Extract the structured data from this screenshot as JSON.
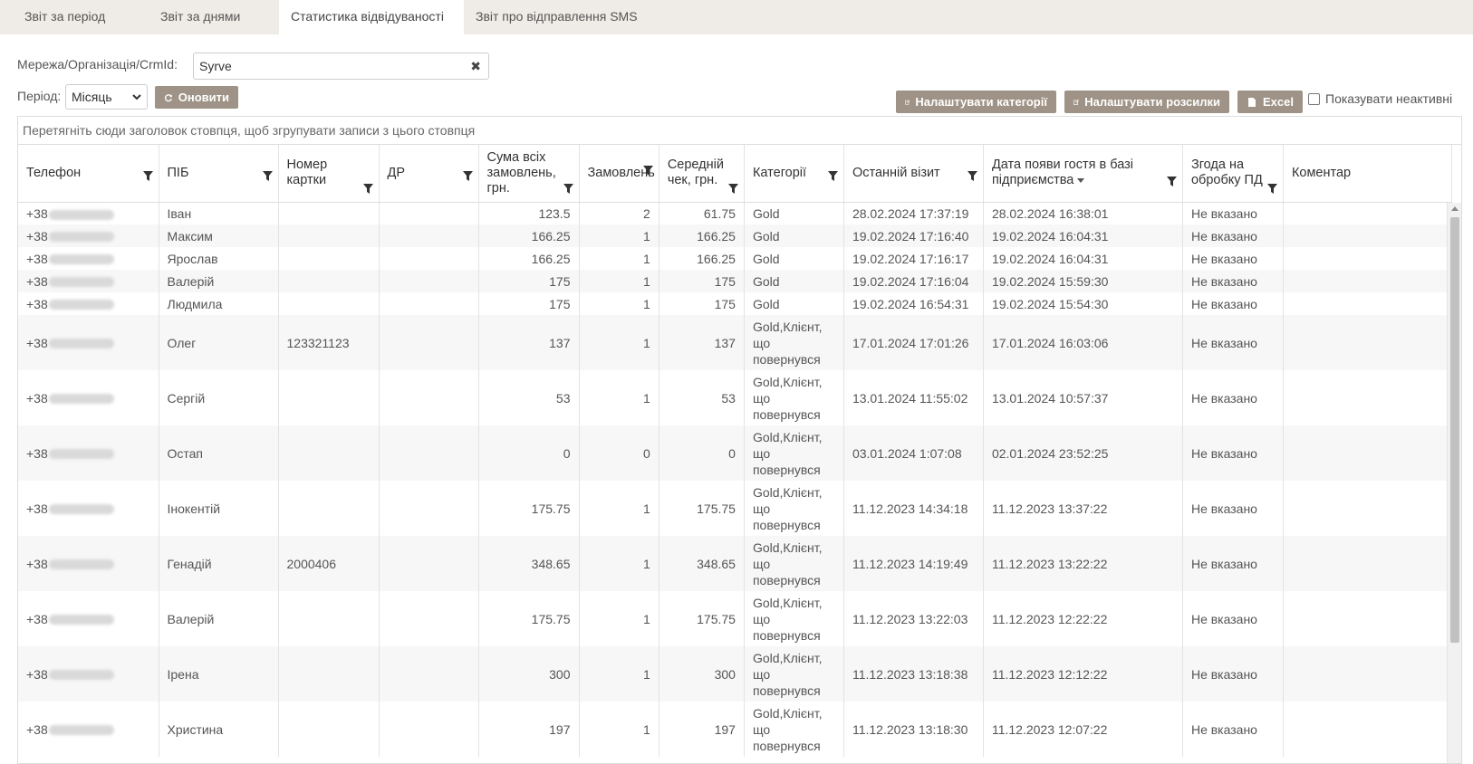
{
  "tabs": [
    {
      "label": "Звіт за період"
    },
    {
      "label": "Звіт за днями"
    },
    {
      "label": "Статистика відвідуваності"
    },
    {
      "label": "Звіт про відправлення SMS"
    }
  ],
  "filters": {
    "org_label": "Мережа/Організація/CrmId:",
    "org_value": "Syrve",
    "clear_glyph": "✖",
    "period_label": "Період:",
    "period_value": "Місяць",
    "refresh_label": "Оновити"
  },
  "actions": {
    "categories_label": "Налаштувати категорії",
    "mailings_label": "Налаштувати розсилки",
    "excel_label": "Excel",
    "show_inactive_label": "Показувати неактивні"
  },
  "grid": {
    "group_hint": "Перетягніть сюди заголовок стовпця, щоб згрупувати записи з цього стовпця",
    "columns": [
      "Телефон",
      "ПІБ",
      "Номер картки",
      "ДР",
      "Сума всіх замовлень, грн.",
      "Замовлень",
      "Середній чек, грн.",
      "Категорії",
      "Останній візит",
      "Дата появи гостя в базі підприємства",
      "Згода на обробку ПД",
      "Коментар"
    ],
    "rows": [
      {
        "phone": "+38",
        "name": "Іван",
        "card": "",
        "dob": "",
        "sum": "123.5",
        "orders": "2",
        "avg": "61.75",
        "cat": "Gold",
        "last": "28.02.2024 17:37:19",
        "created": "28.02.2024 16:38:01",
        "consent": "Не вказано",
        "comment": ""
      },
      {
        "phone": "+38",
        "name": "Максим",
        "card": "",
        "dob": "",
        "sum": "166.25",
        "orders": "1",
        "avg": "166.25",
        "cat": "Gold",
        "last": "19.02.2024 17:16:40",
        "created": "19.02.2024 16:04:31",
        "consent": "Не вказано",
        "comment": ""
      },
      {
        "phone": "+38",
        "name": "Ярослав",
        "card": "",
        "dob": "",
        "sum": "166.25",
        "orders": "1",
        "avg": "166.25",
        "cat": "Gold",
        "last": "19.02.2024 17:16:17",
        "created": "19.02.2024 16:04:31",
        "consent": "Не вказано",
        "comment": ""
      },
      {
        "phone": "+38",
        "name": "Валерій",
        "card": "",
        "dob": "",
        "sum": "175",
        "orders": "1",
        "avg": "175",
        "cat": "Gold",
        "last": "19.02.2024 17:16:04",
        "created": "19.02.2024 15:59:30",
        "consent": "Не вказано",
        "comment": ""
      },
      {
        "phone": "+38",
        "name": "Людмила",
        "card": "",
        "dob": "",
        "sum": "175",
        "orders": "1",
        "avg": "175",
        "cat": "Gold",
        "last": "19.02.2024 16:54:31",
        "created": "19.02.2024 15:54:30",
        "consent": "Не вказано",
        "comment": ""
      },
      {
        "phone": "+38",
        "name": "Олег",
        "card": "123321123",
        "dob": "",
        "sum": "137",
        "orders": "1",
        "avg": "137",
        "cat": "Gold,Клієнт, що повернувся",
        "last": "17.01.2024 17:01:26",
        "created": "17.01.2024 16:03:06",
        "consent": "Не вказано",
        "comment": ""
      },
      {
        "phone": "+38",
        "name": "Сергій",
        "card": "",
        "dob": "",
        "sum": "53",
        "orders": "1",
        "avg": "53",
        "cat": "Gold,Клієнт, що повернувся",
        "last": "13.01.2024 11:55:02",
        "created": "13.01.2024 10:57:37",
        "consent": "Не вказано",
        "comment": ""
      },
      {
        "phone": "+38",
        "name": "Остап",
        "card": "",
        "dob": "",
        "sum": "0",
        "orders": "0",
        "avg": "0",
        "cat": "Gold,Клієнт, що повернувся",
        "last": "03.01.2024 1:07:08",
        "created": "02.01.2024 23:52:25",
        "consent": "Не вказано",
        "comment": ""
      },
      {
        "phone": "+38",
        "name": "Інокентій",
        "card": "",
        "dob": "",
        "sum": "175.75",
        "orders": "1",
        "avg": "175.75",
        "cat": "Gold,Клієнт, що повернувся",
        "last": "11.12.2023 14:34:18",
        "created": "11.12.2023 13:37:22",
        "consent": "Не вказано",
        "comment": ""
      },
      {
        "phone": "+38",
        "name": "Генадій",
        "card": "2000406",
        "dob": "",
        "sum": "348.65",
        "orders": "1",
        "avg": "348.65",
        "cat": "Gold,Клієнт, що повернувся",
        "last": "11.12.2023 14:19:49",
        "created": "11.12.2023 13:22:22",
        "consent": "Не вказано",
        "comment": ""
      },
      {
        "phone": "+38",
        "name": "Валерій",
        "card": "",
        "dob": "",
        "sum": "175.75",
        "orders": "1",
        "avg": "175.75",
        "cat": "Gold,Клієнт, що повернувся",
        "last": "11.12.2023 13:22:03",
        "created": "11.12.2023 12:22:22",
        "consent": "Не вказано",
        "comment": ""
      },
      {
        "phone": "+38",
        "name": "Ірена",
        "card": "",
        "dob": "",
        "sum": "300",
        "orders": "1",
        "avg": "300",
        "cat": "Gold,Клієнт, що повернувся",
        "last": "11.12.2023 13:18:38",
        "created": "11.12.2023 12:12:22",
        "consent": "Не вказано",
        "comment": ""
      },
      {
        "phone": "+38",
        "name": "Христина",
        "card": "",
        "dob": "",
        "sum": "197",
        "orders": "1",
        "avg": "197",
        "cat": "Gold,Клієнт, що повернувся",
        "last": "11.12.2023 13:18:30",
        "created": "11.12.2023 12:07:22",
        "consent": "Не вказано",
        "comment": ""
      }
    ]
  },
  "colors": {
    "tabbar_bg": "#efebe6",
    "button_bg": "#9e9386"
  }
}
